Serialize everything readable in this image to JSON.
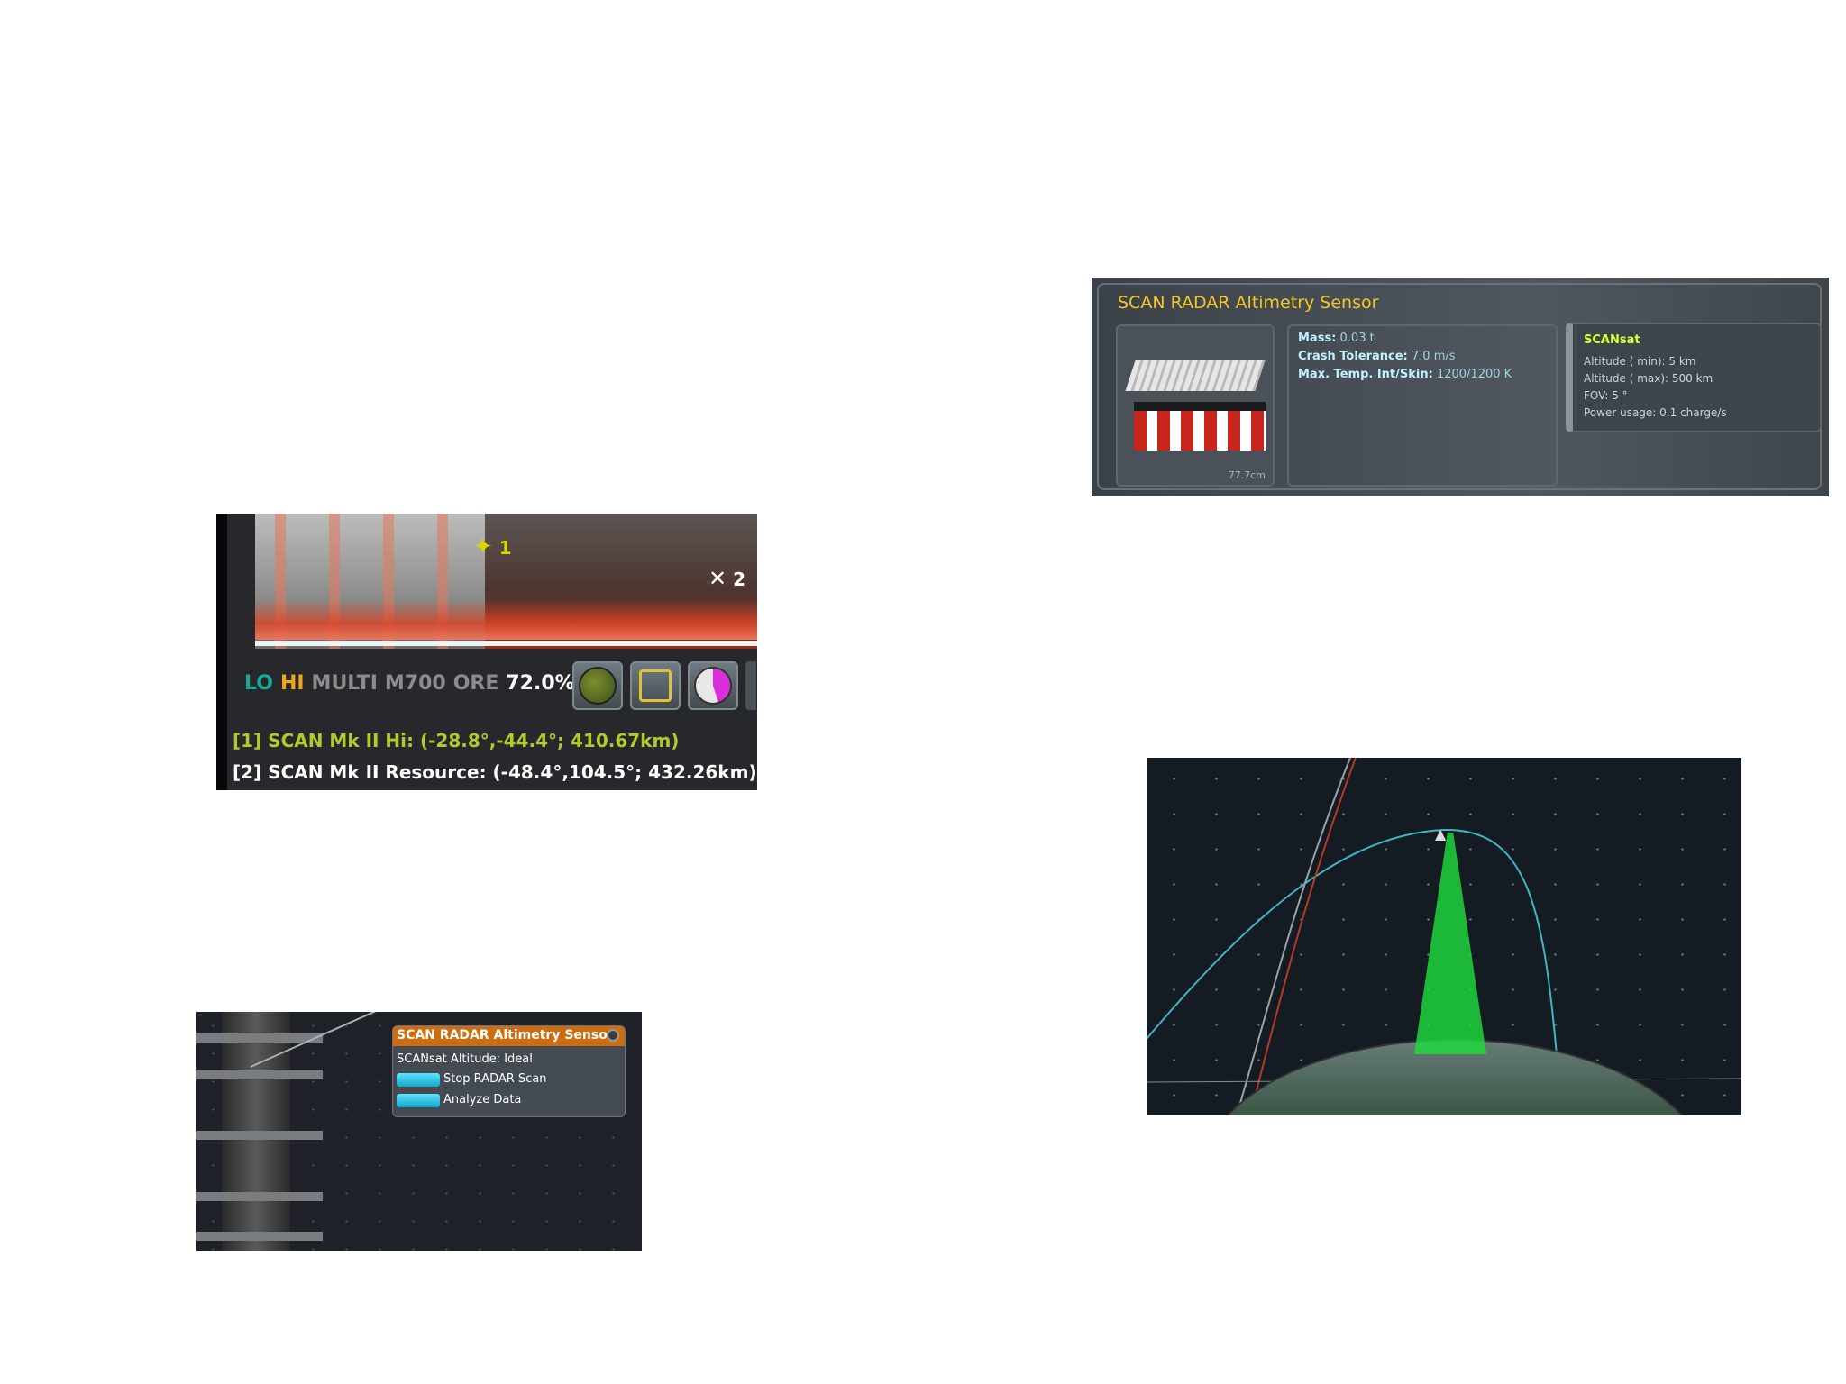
{
  "scan_map": {
    "sat1_label": "1",
    "sat2_label": "2",
    "legend": {
      "lo": "LO",
      "hi": "HI",
      "multi": "MULTI",
      "m700": "M700",
      "ore": "ORE",
      "percent": "72.0%"
    },
    "vessel_lines": [
      "[1] SCAN Mk II Hi: (-28.8°,-44.4°; 410.67km)",
      "[2] SCAN Mk II Resource: (-48.4°,104.5°; 432.26km)"
    ],
    "icons": [
      "satellite-icon",
      "globe-icon",
      "zoom-icon",
      "planet-overlay-icon"
    ],
    "colors": {
      "lo": "#19a89a",
      "hi": "#f0a51d",
      "line1": "#b5c92a"
    }
  },
  "part_info": {
    "title": "SCAN RADAR Altimetry Sensor",
    "thumb_size": "77.7cm",
    "stats": [
      {
        "label": "Mass:",
        "value": "0.03 t"
      },
      {
        "label": "Crash Tolerance:",
        "value": "7.0 m/s"
      },
      {
        "label": "Max. Temp. Int/Skin:",
        "value": "1200/1200 K"
      }
    ],
    "module": {
      "title": "SCANsat",
      "lines": [
        "Altitude ( min): 5 km",
        "Altitude ( max): 500 km",
        "FOV: 5 °",
        "Power usage: 0.1 charge/s"
      ]
    }
  },
  "paw": {
    "title": "SCAN RADAR Altimetry Sensor",
    "status": "SCANsat Altitude: Ideal",
    "buttons": [
      "Stop RADAR Scan",
      "Analyze Data"
    ]
  }
}
